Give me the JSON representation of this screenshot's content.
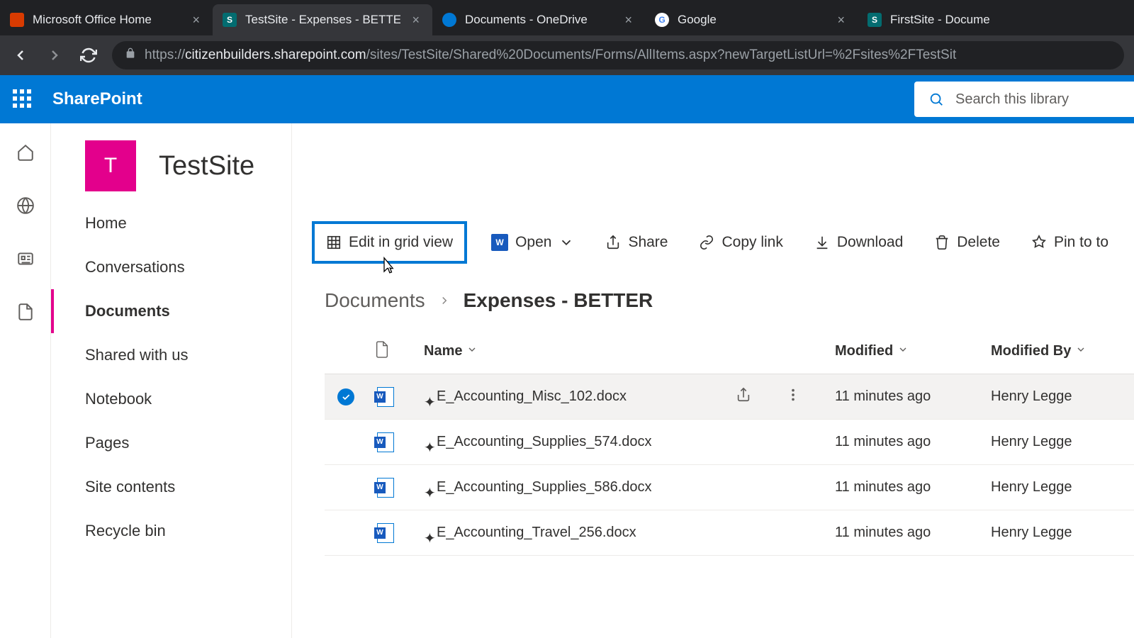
{
  "browser": {
    "tabs": [
      {
        "title": "Microsoft Office Home",
        "fav_bg": "#d83b01",
        "fav_text": ""
      },
      {
        "title": "TestSite - Expenses - BETTE",
        "fav_bg": "#036c70",
        "fav_text": "S"
      },
      {
        "title": "Documents - OneDrive",
        "fav_bg": "#0078d4",
        "fav_text": ""
      },
      {
        "title": "Google",
        "fav_bg": "#fff",
        "fav_text": "G"
      },
      {
        "title": "FirstSite - Docume",
        "fav_bg": "#036c70",
        "fav_text": "S"
      }
    ],
    "url_prefix": "https://",
    "url_host": "citizenbuilders.sharepoint.com",
    "url_path": "/sites/TestSite/Shared%20Documents/Forms/AllItems.aspx?newTargetListUrl=%2Fsites%2FTestSit"
  },
  "header": {
    "brand": "SharePoint",
    "search_placeholder": "Search this library"
  },
  "site": {
    "logo_letter": "T",
    "title": "TestSite"
  },
  "nav": {
    "items": [
      "Home",
      "Conversations",
      "Documents",
      "Shared with us",
      "Notebook",
      "Pages",
      "Site contents",
      "Recycle bin"
    ],
    "active_index": 2
  },
  "toolbar": {
    "edit_grid": "Edit in grid view",
    "open": "Open",
    "share": "Share",
    "copy_link": "Copy link",
    "download": "Download",
    "delete": "Delete",
    "pin": "Pin to to"
  },
  "breadcrumb": {
    "root": "Documents",
    "current": "Expenses - BETTER"
  },
  "table": {
    "headers": {
      "name": "Name",
      "modified": "Modified",
      "modified_by": "Modified By"
    },
    "rows": [
      {
        "name": "E_Accounting_Misc_102.docx",
        "modified": "11 minutes ago",
        "by": "Henry Legge",
        "selected": true
      },
      {
        "name": "E_Accounting_Supplies_574.docx",
        "modified": "11 minutes ago",
        "by": "Henry Legge",
        "selected": false
      },
      {
        "name": "E_Accounting_Supplies_586.docx",
        "modified": "11 minutes ago",
        "by": "Henry Legge",
        "selected": false
      },
      {
        "name": "E_Accounting_Travel_256.docx",
        "modified": "11 minutes ago",
        "by": "Henry Legge",
        "selected": false
      }
    ]
  }
}
